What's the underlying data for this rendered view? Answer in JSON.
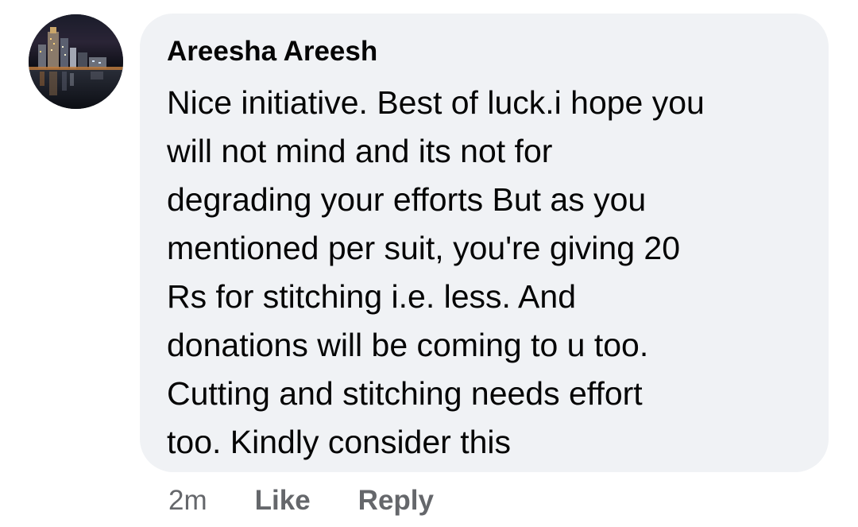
{
  "comment": {
    "author": "Areesha Areesh",
    "avatar_icon": "city-night-skyline-avatar",
    "lines": [
      "Nice initiative. Best of luck.i hope you",
      "will not mind and its not for",
      "degrading your efforts But as you",
      "mentioned per suit, you're giving 20",
      "Rs for stitching i.e. less. And",
      "donations will be coming to u too.",
      "Cutting and stitching needs effort",
      "too. Kindly consider this"
    ],
    "timestamp": "2m",
    "like_label": "Like",
    "reply_label": "Reply"
  },
  "colors": {
    "bubble_bg": "#f0f2f5",
    "text": "#050505",
    "meta_text": "#65676b"
  }
}
